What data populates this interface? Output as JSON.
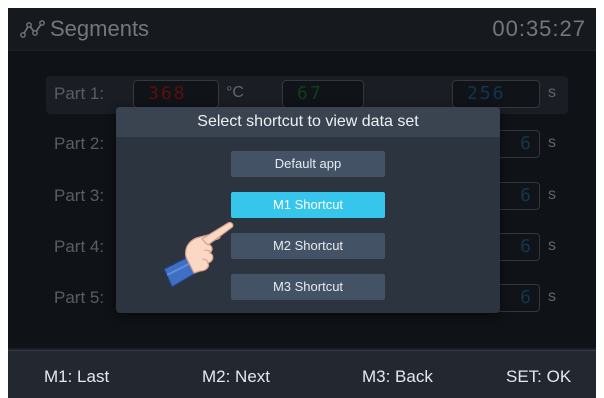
{
  "header": {
    "title": "Segments",
    "time": "00:35:27",
    "logo_icon": "signal-wave-icon"
  },
  "segments": [
    {
      "label": "Part 1:",
      "temperature": "368",
      "temp_unit": "°C",
      "value": "67",
      "duration": "256",
      "duration_unit": "s"
    },
    {
      "label": "Part 2:",
      "duration_partial": "6",
      "duration_unit": "s"
    },
    {
      "label": "Part 3:",
      "duration_partial": "6",
      "duration_unit": "s"
    },
    {
      "label": "Part 4:",
      "duration_partial": "6",
      "duration_unit": "s"
    },
    {
      "label": "Part 5:",
      "duration_partial": "6",
      "duration_unit": "s"
    }
  ],
  "colors": {
    "temperature": "#9b1b1b",
    "value": "#1d6b2a",
    "duration": "#1c5e88",
    "selected": "#36c6ec"
  },
  "dialog": {
    "title": "Select shortcut to view data set",
    "options": [
      "Default app",
      "M1 Shortcut",
      "M2 Shortcut",
      "M3 Shortcut"
    ],
    "selected_index": 1
  },
  "pointer": {
    "icon": "pointing-hand-icon"
  },
  "footer": {
    "m1": "M1: Last",
    "m2": "M2: Next",
    "m3": "M3: Back",
    "set": "SET: OK"
  }
}
